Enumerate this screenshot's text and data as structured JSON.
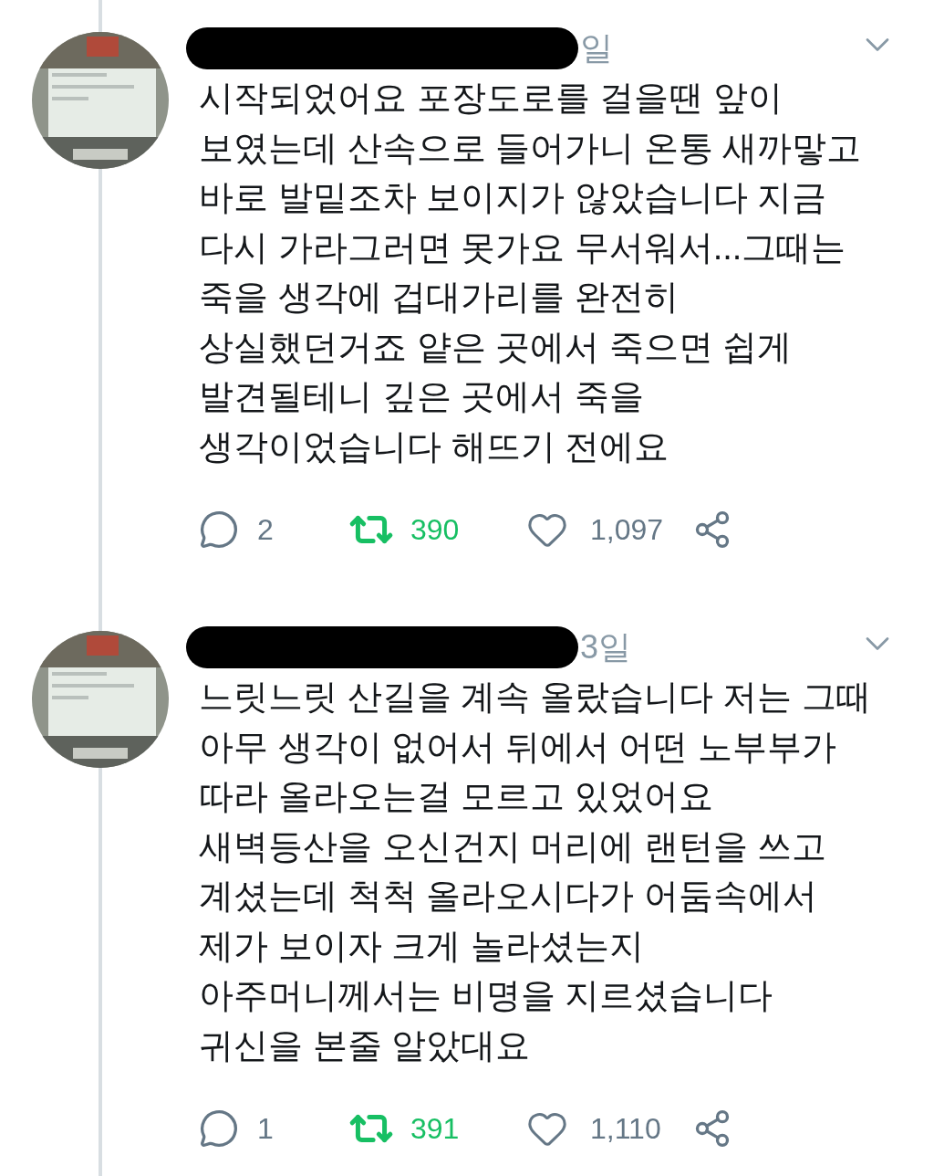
{
  "tweets": [
    {
      "time": "일",
      "text": "시작되었어요 포장도로를 걸을땐 앞이\n보였는데 산속으로 들어가니 온통 새까맣고\n바로 발밑조차 보이지가 않았습니다 지금\n다시 가라그러면 못가요 무서워서...그때는\n죽을 생각에 겁대가리를 완전히\n상실했던거죠 얕은 곳에서 죽으면 쉽게\n발견될테니 깊은 곳에서 죽을\n생각이었습니다 해뜨기 전에요",
      "replies": "2",
      "retweets": "390",
      "retweeted": true,
      "likes": "1,097"
    },
    {
      "time": "3일",
      "text": "느릿느릿 산길을 계속 올랐습니다 저는 그때\n아무 생각이 없어서 뒤에서 어떤 노부부가\n따라 올라오는걸 모르고 있었어요\n새벽등산을 오신건지 머리에 랜턴을 쓰고\n계셨는데 척척 올라오시다가 어둠속에서\n제가 보이자 크게 놀라셨는지\n아주머니께서는 비명을 지르셨습니다\n귀신을 본줄 알았대요",
      "replies": "1",
      "retweets": "391",
      "retweeted": true,
      "likes": "1,110"
    }
  ]
}
